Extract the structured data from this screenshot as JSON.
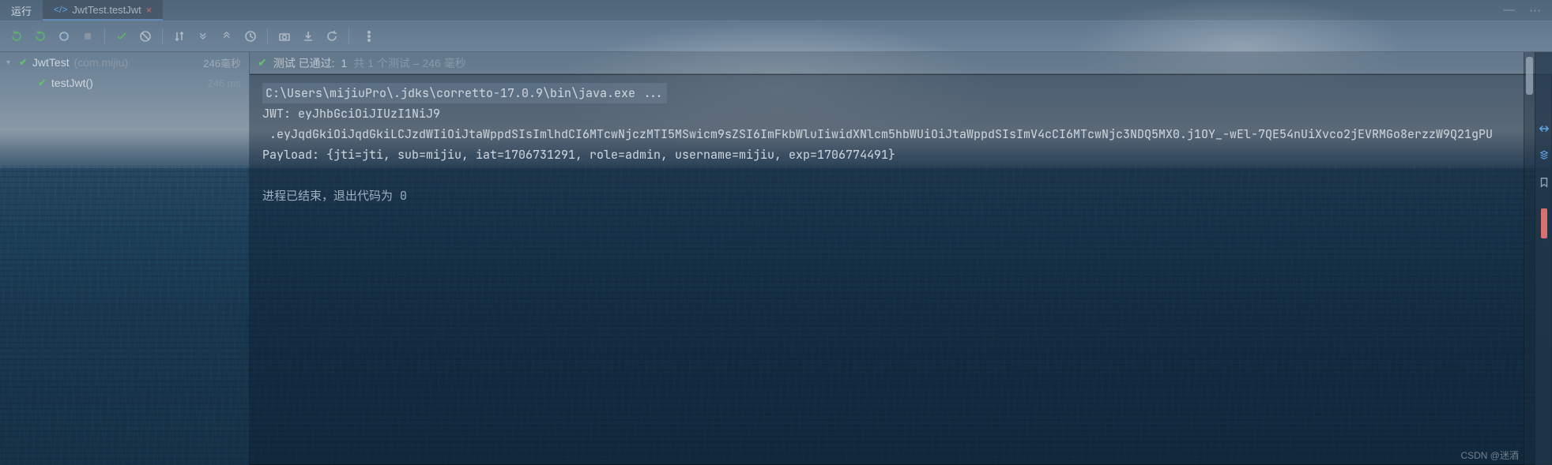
{
  "tabs": {
    "run_label": "运行",
    "file_tab": "JwtTest.testJwt"
  },
  "toolbar_icons": {
    "rerun": "rerun-icon",
    "rerun_failed": "rerun-failed-icon",
    "toggle_auto": "auto-test-icon",
    "stop": "stop-icon",
    "show_passed": "check-icon",
    "show_ignored": "ignored-icon",
    "sort": "sort-icon",
    "expand": "expand-icon",
    "collapse": "collapse-icon",
    "clock": "clock-icon",
    "import": "import-icon",
    "export": "export-icon",
    "settings": "settings-icon",
    "more": "more-icon"
  },
  "tree": {
    "root": {
      "name": "JwtTest",
      "pkg": "(com.mijiu)",
      "duration": "246毫秒"
    },
    "child": {
      "name": "testJwt()",
      "duration": "246 ms"
    }
  },
  "test_header": {
    "prefix": "测试 已通过:",
    "count": "1",
    "faded": "共 1 个测试 – 246 毫秒"
  },
  "console": {
    "cmd": "C:\\Users\\mijiuPro\\.jdks\\corretto-17.0.9\\bin\\java.exe ...",
    "l1": "JWT: eyJhbGciOiJIUzI1NiJ9",
    "l2": ".eyJqdGkiOiJqdGkiLCJzdWIiOiJtaWppdSIsImlhdCI6MTcwNjczMTI5MSwicm9sZSI6ImFkbWluIiwidXNlcm5hbWUiOiJtaWppdSIsImV4cCI6MTcwNjc3NDQ5MX0.j1OY_-wEl-7QE54nUiXvco2jEVRMGo8erzzW9Q21gPU",
    "l3": "Payload: {jti=jti, sub=mijiu, iat=1706731291, role=admin, username=mijiu, exp=1706774491}",
    "exit": "进程已结束，退出代码为 0"
  },
  "watermark": "CSDN @迷酒"
}
